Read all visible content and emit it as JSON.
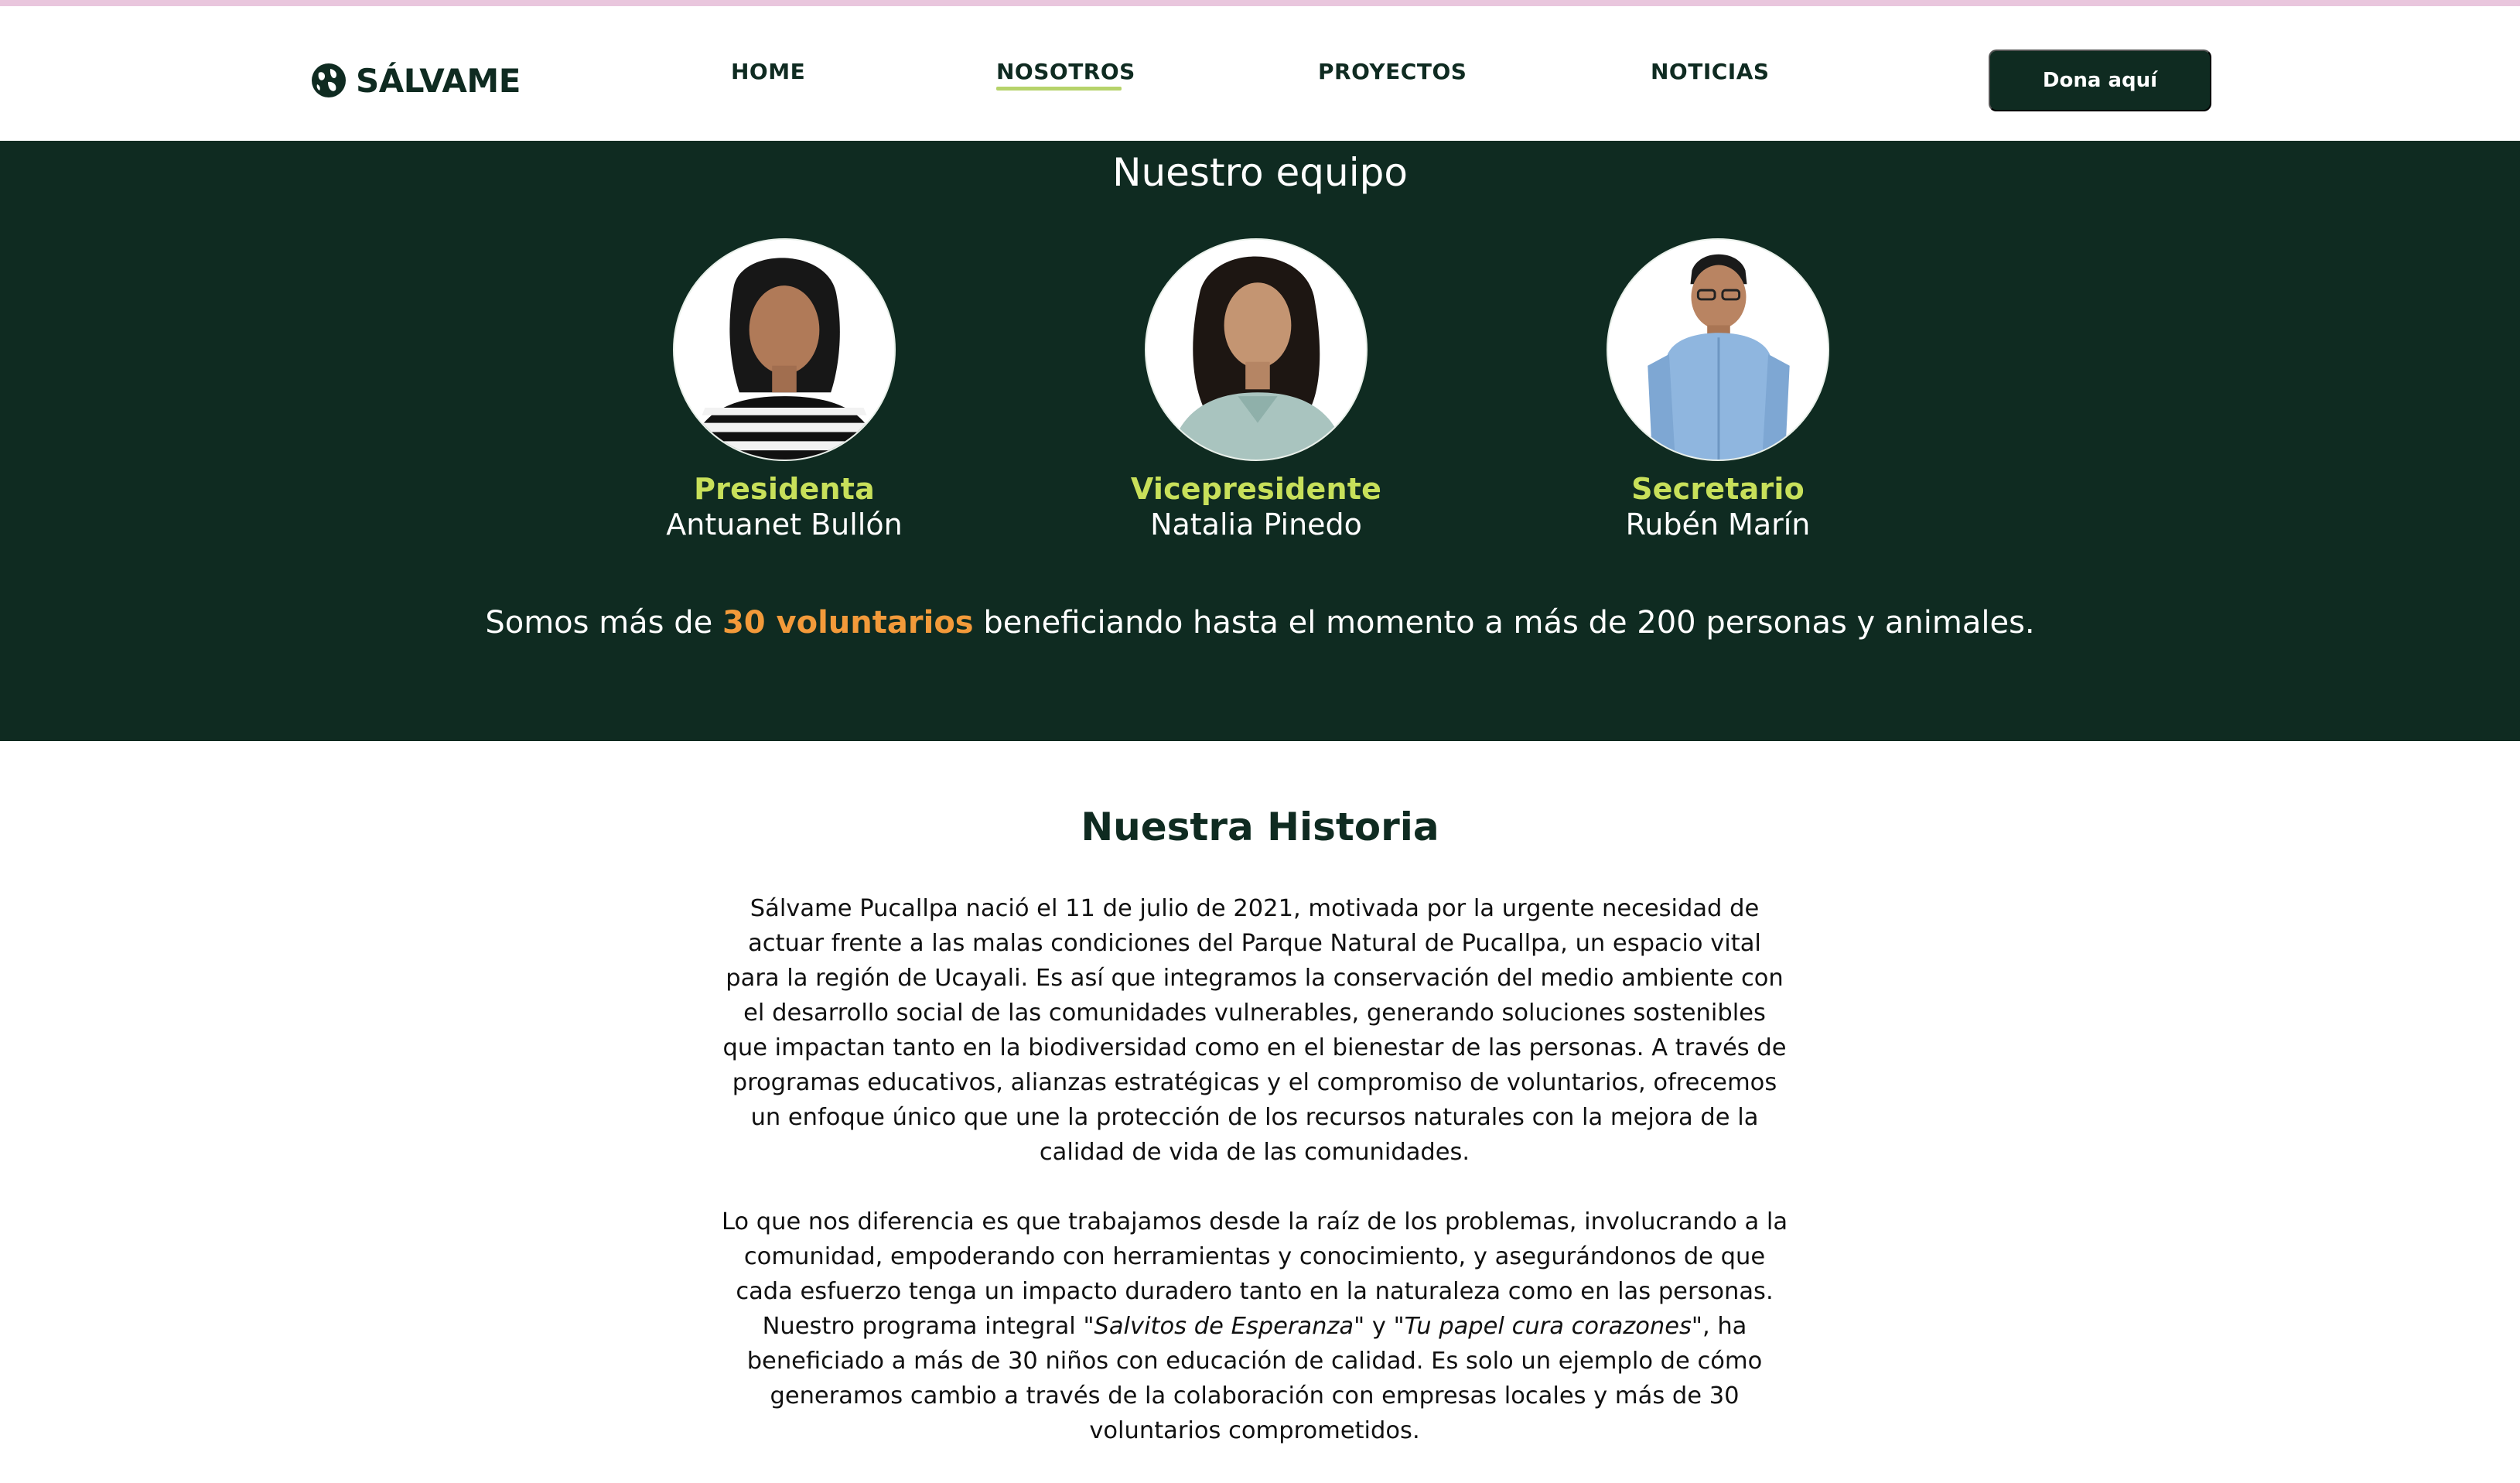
{
  "brand": {
    "name": "SÁLVAME",
    "logo_icon": "globe-icon"
  },
  "nav": {
    "items": [
      {
        "label": "HOME",
        "active": false
      },
      {
        "label": "NOSOTROS",
        "active": true
      },
      {
        "label": "PROYECTOS",
        "active": false
      },
      {
        "label": "NOTICIAS",
        "active": false
      }
    ],
    "donate_label": "Dona aquí"
  },
  "team": {
    "title": "Nuestro equipo",
    "members": [
      {
        "role": "Presidenta",
        "name": "Antuanet Bullón"
      },
      {
        "role": "Vicepresidente",
        "name": "Natalia Pinedo"
      },
      {
        "role": "Secretario",
        "name": "Rubén Marín"
      }
    ],
    "volunteers": {
      "before": "Somos más de ",
      "highlight": "30 voluntarios",
      "after": " beneficiando hasta el momento a más de 200 personas y animales."
    }
  },
  "history": {
    "title": "Nuestra Historia",
    "paragraph1": "Sálvame Pucallpa nació el 11 de julio de 2021, motivada por la urgente necesidad de actuar frente a las malas condiciones del Parque Natural de Pucallpa, un espacio vital para la región de Ucayali. Es así que integramos la conservación del medio ambiente con el desarrollo social de las comunidades vulnerables, generando soluciones sostenibles que impactan tanto en la biodiversidad como en el bienestar de las personas. A través de programas educativos, alianzas estratégicas y el compromiso de voluntarios, ofrecemos un enfoque único que une la protección de los recursos naturales con la mejora de la calidad de vida de las comunidades.",
    "paragraph2": {
      "part1": "Lo que nos diferencia es que trabajamos desde la raíz de los problemas, involucrando a la comunidad, empoderando con herramientas y conocimiento, y asegurándonos de que cada esfuerzo tenga un impacto duradero tanto en la naturaleza como en las personas. Nuestro programa integral ",
      "italic1": "\"Salvitos de Esperanza\"",
      "part2": " y ",
      "italic2": "\"Tu papel cura corazones\"",
      "part3": ", ha beneficiado a más de 30 niños con educación de calidad. Es solo un ejemplo de cómo generamos cambio a través de la colaboración con empresas locales y más de 30 voluntarios comprometidos."
    }
  },
  "colors": {
    "dark_green": "#0f2b21",
    "lime": "#c8e05a",
    "orange": "#f39a3a",
    "nav_underline": "#b6d36a",
    "top_accent": "#e9c6dd"
  }
}
